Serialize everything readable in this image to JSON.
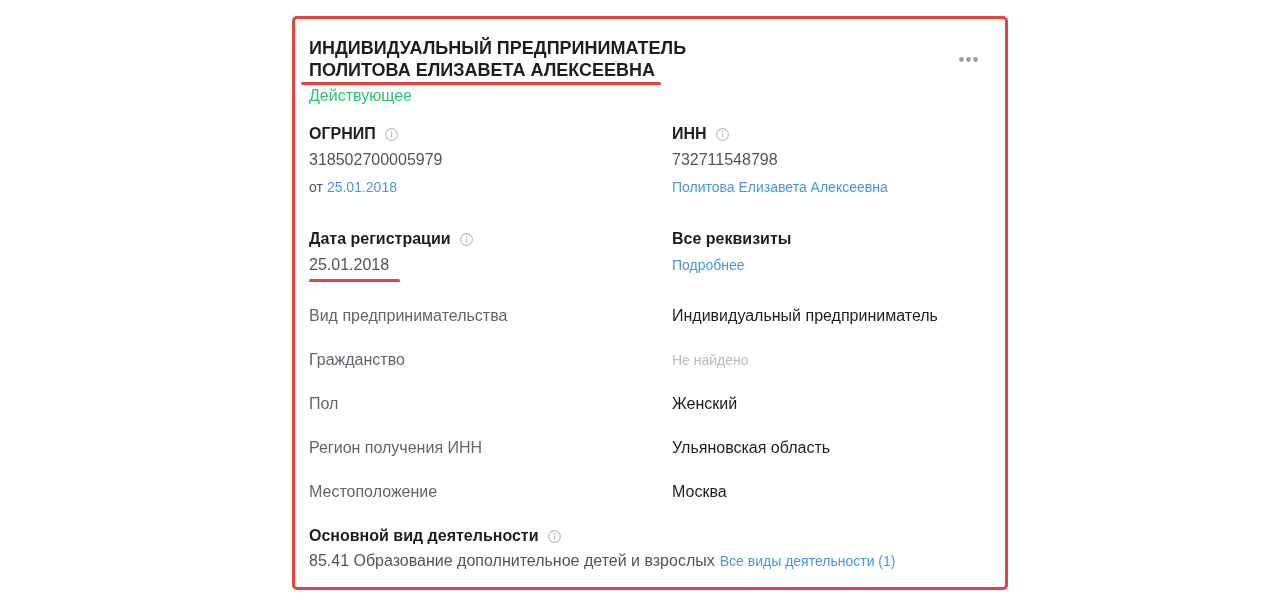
{
  "card": {
    "title": {
      "type_line": "ИНДИВИДУАЛЬНЫЙ ПРЕДПРИНИМАТЕЛЬ",
      "name_line": "ПОЛИТОВА ЕЛИЗАВЕТА АЛЕКСЕЕВНА",
      "name_underlined": true
    },
    "status": {
      "text": "Действующее",
      "kind": "active"
    },
    "fields": [
      {
        "kind": "value",
        "label": "ОГРНИП",
        "info": true,
        "value": "318502700005979",
        "underlined": false,
        "note": {
          "prefix": "от",
          "link": "25.01.2018"
        }
      },
      {
        "kind": "value",
        "label": "ИНН",
        "info": true,
        "value": "732711548798",
        "underlined": false,
        "note": {
          "link": "Политова Елизавета Алексеевна"
        }
      },
      {
        "kind": "value",
        "label": "Дата регистрации",
        "info": true,
        "value": "25.01.2018",
        "underlined": true
      },
      {
        "kind": "link",
        "label": "Все реквизиты",
        "info": false,
        "link": "Подробнее"
      }
    ],
    "details": [
      {
        "label": "Вид предпринимательства",
        "value": "Индивидуальный предприниматель",
        "missing": false
      },
      {
        "label": "Гражданство",
        "value": "Не найдено",
        "missing": true
      },
      {
        "label": "Пол",
        "value": "Женский",
        "missing": false
      },
      {
        "label": "Регион получения ИНН",
        "value": "Ульяновская область",
        "missing": false
      },
      {
        "label": "Местоположение",
        "value": "Москва",
        "missing": false
      }
    ],
    "main_activity": {
      "label": "Основной вид деятельности",
      "info": true,
      "text": "85.41 Образование дополнительное детей и взрослых",
      "link": "Все виды деятельности (1)"
    }
  }
}
